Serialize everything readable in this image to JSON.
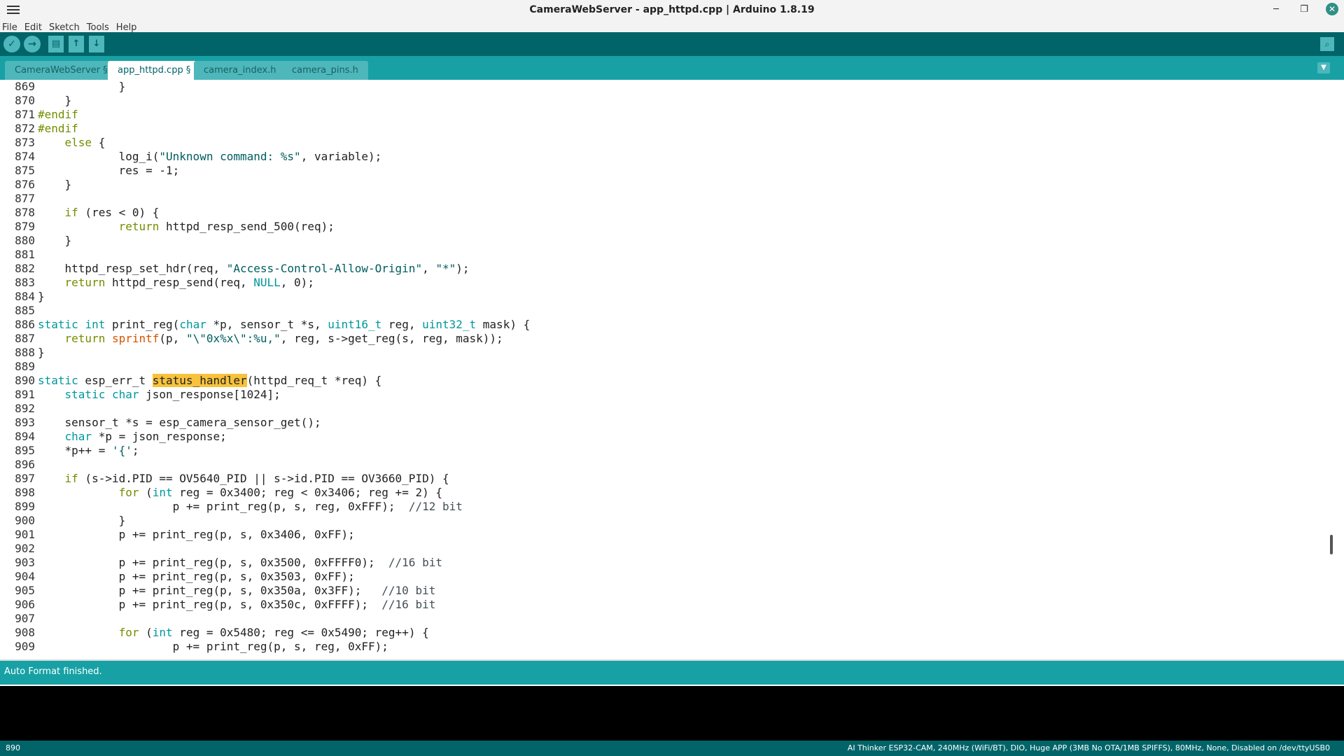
{
  "window": {
    "title": "CameraWebServer - app_httpd.cpp | Arduino 1.8.19"
  },
  "menu": [
    "File",
    "Edit",
    "Sketch",
    "Tools",
    "Help"
  ],
  "toolbar": {
    "verify": "✓",
    "upload": "→",
    "new": "▤",
    "open": "↑",
    "save": "↓",
    "serial": "⌕"
  },
  "tabs": [
    "CameraWebServer §",
    "app_httpd.cpp §",
    "camera_index.h",
    "camera_pins.h"
  ],
  "active_tab": 1,
  "code_lines": [
    {
      "n": "869",
      "t": "            }"
    },
    {
      "n": "870",
      "t": "    }"
    },
    {
      "n": "871",
      "t": "#endif"
    },
    {
      "n": "872",
      "t": "#endif"
    },
    {
      "n": "873",
      "t": "    else {"
    },
    {
      "n": "874",
      "t": "            log_i(\"Unknown command: %s\", variable);"
    },
    {
      "n": "875",
      "t": "            res = -1;"
    },
    {
      "n": "876",
      "t": "    }"
    },
    {
      "n": "877",
      "t": ""
    },
    {
      "n": "878",
      "t": "    if (res < 0) {"
    },
    {
      "n": "879",
      "t": "            return httpd_resp_send_500(req);"
    },
    {
      "n": "880",
      "t": "    }"
    },
    {
      "n": "881",
      "t": ""
    },
    {
      "n": "882",
      "t": "    httpd_resp_set_hdr(req, \"Access-Control-Allow-Origin\", \"*\");"
    },
    {
      "n": "883",
      "t": "    return httpd_resp_send(req, NULL, 0);"
    },
    {
      "n": "884",
      "t": "}"
    },
    {
      "n": "885",
      "t": ""
    },
    {
      "n": "886",
      "t": "static int print_reg(char *p, sensor_t *s, uint16_t reg, uint32_t mask) {"
    },
    {
      "n": "887",
      "t": "    return sprintf(p, \"\\\"0x%x\\\":%u,\", reg, s->get_reg(s, reg, mask));"
    },
    {
      "n": "888",
      "t": "}"
    },
    {
      "n": "889",
      "t": ""
    },
    {
      "n": "890",
      "t": "static esp_err_t status_handler(httpd_req_t *req) {"
    },
    {
      "n": "891",
      "t": "    static char json_response[1024];"
    },
    {
      "n": "892",
      "t": ""
    },
    {
      "n": "893",
      "t": "    sensor_t *s = esp_camera_sensor_get();"
    },
    {
      "n": "894",
      "t": "    char *p = json_response;"
    },
    {
      "n": "895",
      "t": "    *p++ = '{';"
    },
    {
      "n": "896",
      "t": ""
    },
    {
      "n": "897",
      "t": "    if (s->id.PID == OV5640_PID || s->id.PID == OV3660_PID) {"
    },
    {
      "n": "898",
      "t": "            for (int reg = 0x3400; reg < 0x3406; reg += 2) {"
    },
    {
      "n": "899",
      "t": "                    p += print_reg(p, s, reg, 0xFFF);  //12 bit"
    },
    {
      "n": "900",
      "t": "            }"
    },
    {
      "n": "901",
      "t": "            p += print_reg(p, s, 0x3406, 0xFF);"
    },
    {
      "n": "902",
      "t": ""
    },
    {
      "n": "903",
      "t": "            p += print_reg(p, s, 0x3500, 0xFFFF0);  //16 bit"
    },
    {
      "n": "904",
      "t": "            p += print_reg(p, s, 0x3503, 0xFF);"
    },
    {
      "n": "905",
      "t": "            p += print_reg(p, s, 0x350a, 0x3FF);   //10 bit"
    },
    {
      "n": "906",
      "t": "            p += print_reg(p, s, 0x350c, 0xFFFF);  //16 bit"
    },
    {
      "n": "907",
      "t": ""
    },
    {
      "n": "908",
      "t": "            for (int reg = 0x5480; reg <= 0x5490; reg++) {"
    },
    {
      "n": "909",
      "t": "                    p += print_reg(p, s, reg, 0xFF);"
    }
  ],
  "highlight_word": "status_handler",
  "status": {
    "message": "Auto Format finished."
  },
  "bottom": {
    "line_number": "890",
    "board_info": "AI Thinker ESP32-CAM, 240MHz (WiFi/BT), DIO, Huge APP (3MB No OTA/1MB SPIFFS), 80MHz, None, Disabled on /dev/ttyUSB0"
  },
  "colors": {
    "toolbar": "#006468",
    "tabbar": "#17a1a5",
    "highlight": "#f7c23c"
  }
}
